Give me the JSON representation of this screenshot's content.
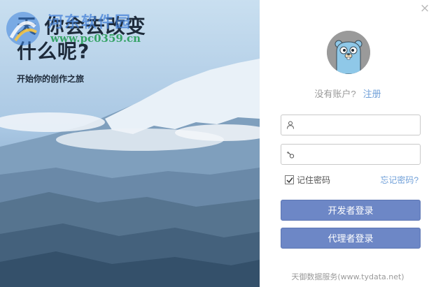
{
  "hero": {
    "title_line1": "天 你会去改变",
    "title_line2": "什么呢?",
    "subtitle": "开始你的创作之旅"
  },
  "watermark": {
    "text": "河东软件园",
    "url": "www.pc0359.cn"
  },
  "window": {
    "close_label": "×"
  },
  "login": {
    "no_account": "没有账户?",
    "register": "注册",
    "username": {
      "value": "",
      "placeholder": ""
    },
    "password": {
      "value": "",
      "placeholder": ""
    },
    "remember_label": "记住密码",
    "remember_checked": true,
    "forgot_label": "忘记密码?",
    "developer_login": "开发者登录",
    "agent_login": "代理者登录"
  },
  "footer": {
    "text": "天御数据服务(www.tydata.net)"
  },
  "colors": {
    "accent_button": "#6d87c6",
    "link": "#6f9fd8",
    "muted_text": "#9a9a9a"
  },
  "icons": {
    "username": "user-icon",
    "password": "key-icon",
    "avatar": "gopher-avatar-icon",
    "close": "close-icon",
    "watermark_logo": "watermark-logo-icon"
  }
}
